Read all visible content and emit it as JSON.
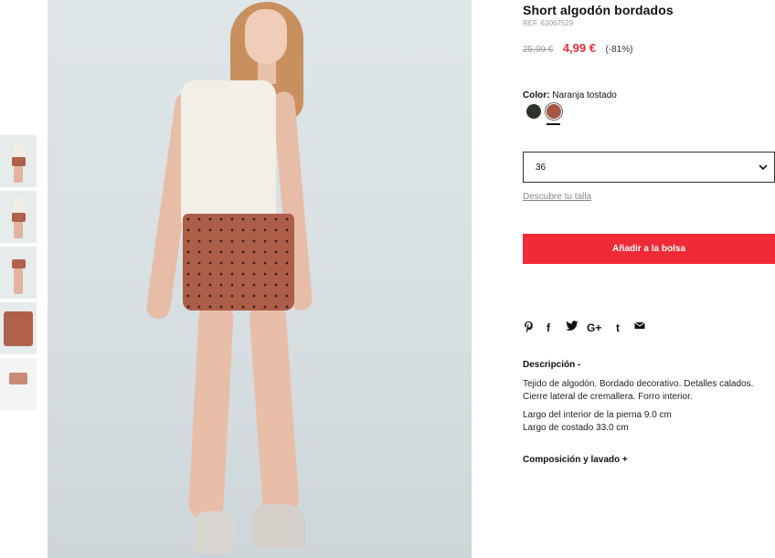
{
  "product": {
    "title": "Short algodón bordados",
    "ref": "REF. 63067529",
    "old_price": "25,99 €",
    "new_price": "4,99 €",
    "discount": "(-81%)"
  },
  "color": {
    "label": "Color:",
    "selected": "Naranja tostado",
    "options": [
      "#2e3328",
      "#a55744"
    ]
  },
  "size": {
    "selected": "36",
    "guide_link": "Descubre tu talla"
  },
  "cart": {
    "add_label": "Añadir a la bolsa"
  },
  "share": {
    "icons": [
      "pinterest-icon",
      "facebook-icon",
      "twitter-icon",
      "google-plus-icon",
      "tumblr-icon",
      "email-icon"
    ],
    "google_plus_text": "G+",
    "tumblr_text": "t",
    "facebook_text": "f"
  },
  "description": {
    "title": "Descripción -",
    "lines1": [
      "Tejido de algodón. Bordado decorativo. Detalles calados.",
      "Cierre lateral de cremallera. Forro interior."
    ],
    "lines2": [
      "Largo del interior de la pierna 9.0 cm",
      "Largo de costado 33.0 cm"
    ]
  },
  "composition": {
    "title": "Composición y lavado +"
  },
  "colors": {
    "accent": "#f02a36",
    "price_sale": "#e62f3b",
    "muted": "#9a9a9a"
  }
}
